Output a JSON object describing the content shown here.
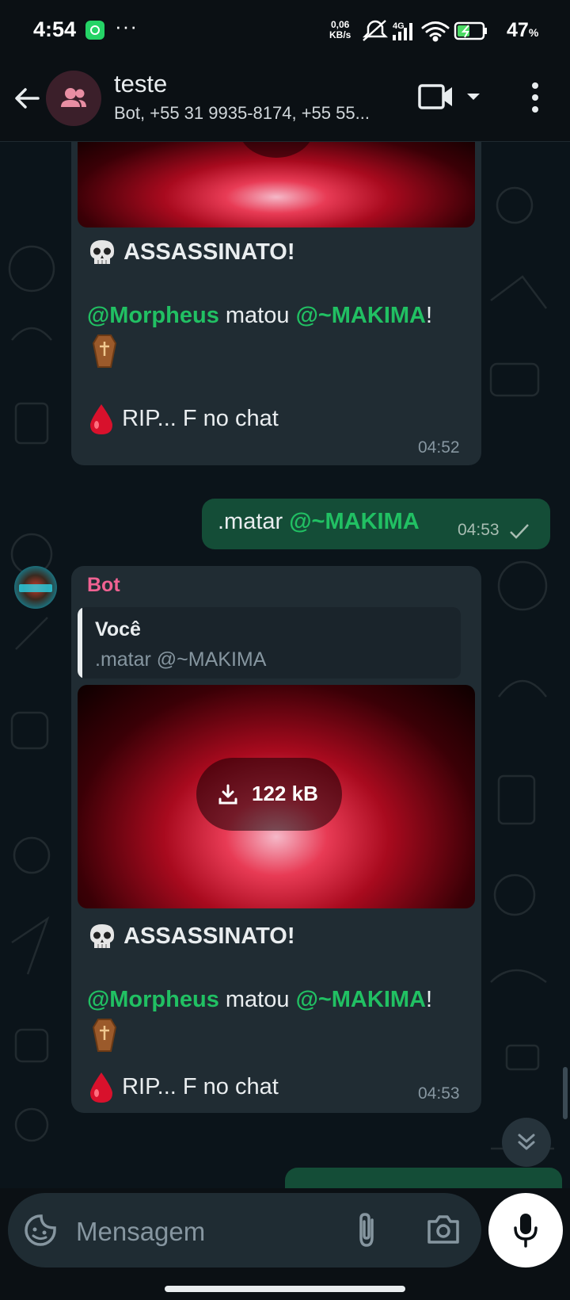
{
  "status_bar": {
    "time": "4:54",
    "more": "···",
    "net_speed_value": "0,06",
    "net_speed_unit": "KB/s",
    "network": "4G",
    "battery": "47",
    "battery_unit": "%"
  },
  "header": {
    "title": "teste",
    "subtitle": "Bot, +55 31 9935-8174, +55 55..."
  },
  "messages": {
    "m1": {
      "headline": "ASSASSINATO!",
      "mention_from": "@Morpheus",
      "verb": " matou ",
      "mention_to": "@~MAKIMA",
      "excl": "!",
      "footer": "RIP... F no chat",
      "time": "04:52"
    },
    "m2": {
      "text": ".matar ",
      "mention": "@~MAKIMA",
      "time": "04:53"
    },
    "m3": {
      "sender": "Bot",
      "reply_author": "Você",
      "reply_text": ".matar @~MAKIMA",
      "download_size": "122 kB",
      "headline": "ASSASSINATO!",
      "mention_from": "@Morpheus",
      "verb": " matou ",
      "mention_to": "@~MAKIMA",
      "excl": "!",
      "footer": "RIP... F no chat",
      "time": "04:53"
    }
  },
  "composer": {
    "placeholder": "Mensagem"
  },
  "colors": {
    "mention": "#21c063",
    "sender_name": "#f06292",
    "outgoing_bubble": "#144d37",
    "incoming_bubble": "#202c33"
  },
  "icons": [
    "whatsapp-icon",
    "back-arrow-icon",
    "group-icon",
    "video-call-icon",
    "chevron-down-icon",
    "more-vert-icon",
    "skull-icon",
    "coffin-icon",
    "blood-drop-icon",
    "check-icon",
    "download-icon",
    "double-chevron-down-icon",
    "sticker-icon",
    "attach-icon",
    "camera-icon",
    "mic-icon"
  ]
}
